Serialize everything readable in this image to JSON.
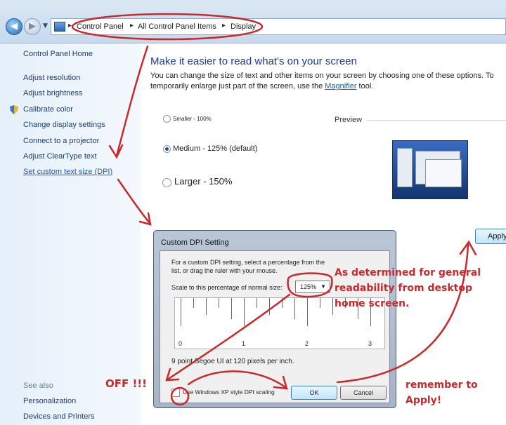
{
  "address_bar": {
    "breadcrumbs": [
      "Control Panel",
      "All Control Panel Items",
      "Display"
    ]
  },
  "sidebar": {
    "home": "Control Panel Home",
    "links": [
      "Adjust resolution",
      "Adjust brightness",
      "Calibrate color",
      "Change display settings",
      "Connect to a projector",
      "Adjust ClearType text",
      "Set custom text size (DPI)"
    ],
    "see_also_heading": "See also",
    "see_also": [
      "Personalization",
      "Devices and Printers"
    ]
  },
  "main": {
    "title": "Make it easier to read what's on your screen",
    "description_before": "You can change the size of text and other items on your screen by choosing one of these options. To temporarily enlarge just part of the screen, use the ",
    "description_link": "Magnifier",
    "description_after": " tool.",
    "options": [
      {
        "label": "Smaller - 100%",
        "selected": false
      },
      {
        "label": "Medium - 125% (default)",
        "selected": true
      },
      {
        "label": "Larger - 150%",
        "selected": false
      }
    ],
    "preview_label": "Preview",
    "apply_label": "Apply"
  },
  "dialog": {
    "title": "Custom DPI Setting",
    "instructions": "For a custom DPI setting, select a percentage from the list, or drag the ruler with your mouse.",
    "scale_label": "Scale to this percentage of normal size:",
    "scale_value": "125%",
    "ruler_labels": [
      "0",
      "1",
      "2",
      "3"
    ],
    "font_info": "9 point Segoe UI at 120 pixels per inch.",
    "xp_label": "Use Windows XP style DPI scaling",
    "xp_checked": false,
    "ok_label": "OK",
    "cancel_label": "Cancel"
  },
  "annotations": {
    "determined": "As determined for general readability from desktop home screen.",
    "off": "OFF !!!",
    "remember": "remember to Apply!"
  },
  "colors": {
    "annotation": "#c9282d",
    "link": "#1e5aa6",
    "title": "#1c3a8a"
  }
}
